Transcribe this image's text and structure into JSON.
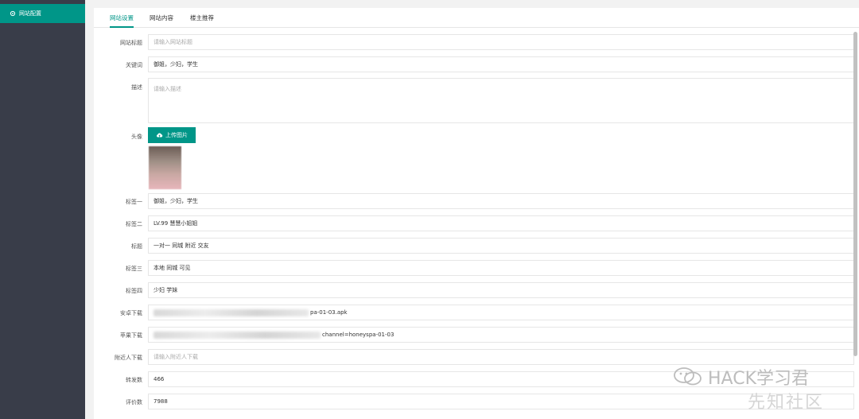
{
  "sidebar": {
    "item_label": "网站配置"
  },
  "tabs": [
    "网站设置",
    "网站内容",
    "楼主推荐"
  ],
  "form": {
    "site_title": {
      "label": "网站标题",
      "placeholder": "请输入网站标题"
    },
    "keywords": {
      "label": "关键词",
      "value": "御姐，少妇，学生"
    },
    "description": {
      "label": "描述",
      "placeholder": "请输入描述"
    },
    "avatar": {
      "label": "头像",
      "upload_label": "上传图片"
    },
    "tag1": {
      "label": "标签一",
      "value": "御姐，少妇，学生"
    },
    "tag2": {
      "label": "标签二",
      "value": "LV.99 慧慧小姐姐"
    },
    "title": {
      "label": "标题",
      "value": "一对一 同城 附近 交友"
    },
    "tag3": {
      "label": "标签三",
      "value": "本地 同城 可见"
    },
    "tag4": {
      "label": "标签四",
      "value": "少妇 学妹"
    },
    "android_download": {
      "label": "安卓下载",
      "value_suffix": "pa-01-03.apk"
    },
    "apple_download": {
      "label": "苹果下载",
      "value_suffix": "channel=honeyspa-01-03"
    },
    "nearby_download": {
      "label": "附近人下载",
      "placeholder": "请输入附近人下载"
    },
    "shares": {
      "label": "转发数",
      "value": "466"
    },
    "reviews": {
      "label": "评价数",
      "value": "7988"
    }
  },
  "watermark": {
    "text": "HACK学习君",
    "subtext": "先知社区"
  }
}
